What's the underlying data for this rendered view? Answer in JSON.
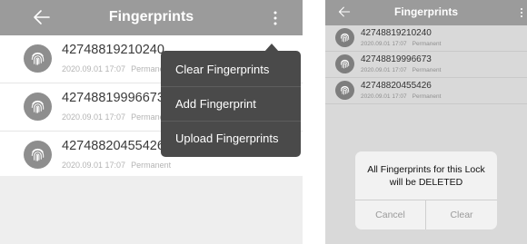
{
  "left_screen": {
    "header": {
      "title": "Fingerprints"
    },
    "fingerprints": [
      {
        "id": "42748819210240",
        "date": "2020.09.01 17:07",
        "validity": "Permanent"
      },
      {
        "id": "42748819996673",
        "date": "2020.09.01 17:07",
        "validity": "Permanent"
      },
      {
        "id": "42748820455426",
        "date": "2020.09.01 17:07",
        "validity": "Permanent"
      }
    ],
    "menu": {
      "items": [
        "Clear Fingerprints",
        "Add Fingerprint",
        "Upload Fingerprints"
      ]
    }
  },
  "right_screen": {
    "header": {
      "title": "Fingerprints"
    },
    "fingerprints": [
      {
        "id": "42748819210240",
        "date": "2020.09.01 17:07",
        "validity": "Permanent"
      },
      {
        "id": "42748819996673",
        "date": "2020.09.01 17:07",
        "validity": "Permanent"
      },
      {
        "id": "42748820455426",
        "date": "2020.09.01 17:07",
        "validity": "Permanent"
      }
    ],
    "dialog": {
      "message_line1": "All Fingerprints for this Lock",
      "message_line2": "will be DELETED",
      "cancel_label": "Cancel",
      "confirm_label": "Clear"
    }
  },
  "icons": {
    "back": "back-arrow-icon",
    "more": "more-vertical-icon",
    "fingerprint": "fingerprint-icon"
  },
  "colors": {
    "header_bg": "#9b9b9b",
    "menu_bg": "#4a4a4a",
    "icon_bg": "#8e8e8e",
    "dialog_bg": "#f2f2f2"
  }
}
